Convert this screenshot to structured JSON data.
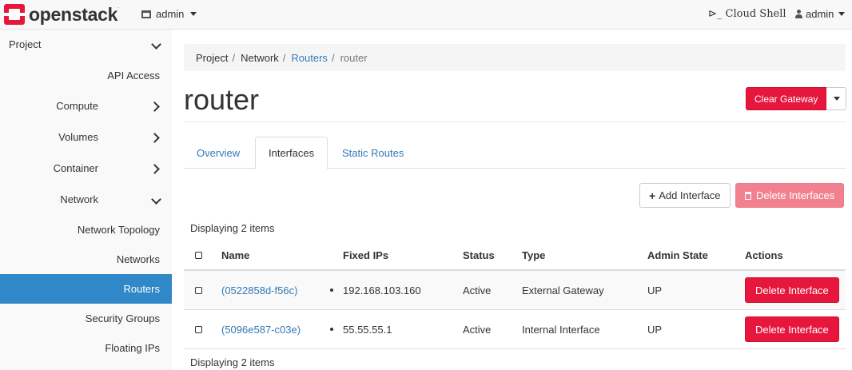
{
  "brand": {
    "name": "openstack",
    "mark": "."
  },
  "topbar": {
    "project_selector": "admin",
    "cloud_shell": "⊳_ Cloud Shell",
    "user_menu": "admin"
  },
  "sidebar": {
    "project": "Project",
    "api_access": "API Access",
    "compute": "Compute",
    "volumes": "Volumes",
    "container": "Container",
    "network": "Network",
    "network_items": [
      "Network Topology",
      "Networks",
      "Routers",
      "Security Groups",
      "Floating IPs"
    ]
  },
  "breadcrumb": {
    "items": [
      "Project",
      "Network",
      "Routers",
      "router"
    ],
    "separator": "/"
  },
  "page_title": "router",
  "actions": {
    "clear_gateway": "Clear Gateway"
  },
  "tabs": [
    "Overview",
    "Interfaces",
    "Static Routes"
  ],
  "table_actions": {
    "add_interface": "Add Interface",
    "delete_interfaces": "Delete Interfaces"
  },
  "count_text": "Displaying 2 items",
  "table": {
    "headers": [
      "Name",
      "Fixed IPs",
      "Status",
      "Type",
      "Admin State",
      "Actions"
    ],
    "rows": [
      {
        "name": "(0522858d-f56c)",
        "fixed_ip": "192.168.103.160",
        "status": "Active",
        "type": "External Gateway",
        "admin_state": "UP",
        "action": "Delete Interface"
      },
      {
        "name": "(5096e587-c03e)",
        "fixed_ip": "55.55.55.1",
        "status": "Active",
        "type": "Internal Interface",
        "admin_state": "UP",
        "action": "Delete Interface"
      }
    ]
  },
  "colors": {
    "brand_red": "#e6163d",
    "active_blue": "#3088c8",
    "link_blue": "#337ab7"
  }
}
